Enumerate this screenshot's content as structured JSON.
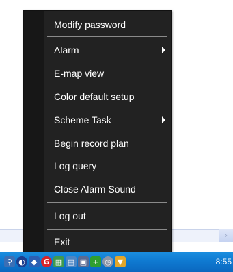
{
  "context_menu": {
    "items": [
      {
        "label": "Modify password",
        "has_submenu": false
      },
      {
        "label": "Alarm",
        "has_submenu": true
      },
      {
        "label": "E-map view",
        "has_submenu": false
      },
      {
        "label": "Color default setup",
        "has_submenu": false
      },
      {
        "label": "Scheme Task",
        "has_submenu": true
      },
      {
        "label": "Begin record plan",
        "has_submenu": false
      },
      {
        "label": "Log query",
        "has_submenu": false
      },
      {
        "label": "Close Alarm Sound",
        "has_submenu": false
      },
      {
        "label": "Log out",
        "has_submenu": false
      },
      {
        "label": "Exit",
        "has_submenu": false
      }
    ]
  },
  "background": {
    "scroll_arrow": "›"
  },
  "taskbar": {
    "clock": "8:55",
    "tray_icons": [
      "network-icon",
      "app-icon",
      "security-icon",
      "antivirus-icon",
      "program-icon",
      "network-drive-icon",
      "monitor-icon",
      "update-icon",
      "clock-app-icon",
      "shield-icon"
    ]
  },
  "colors": {
    "menu_bg": "#222222",
    "menu_text": "#ffffff",
    "taskbar": "#0f7ad1"
  }
}
